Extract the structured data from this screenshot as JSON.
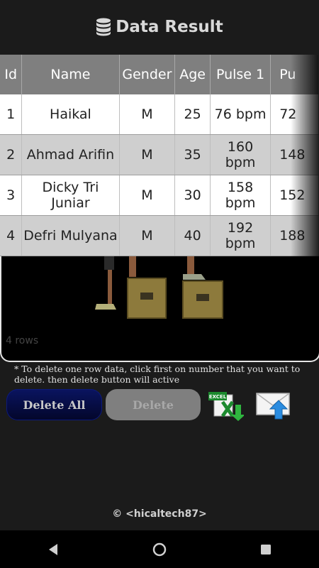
{
  "header": {
    "title": "Data Result",
    "icon": "database-icon"
  },
  "table": {
    "columns": [
      "Id",
      "Name",
      "Gender",
      "Age",
      "Pulse 1",
      "Pu"
    ],
    "rows": [
      [
        "1",
        "Haikal",
        "M",
        "25",
        "76 bpm",
        "72"
      ],
      [
        "2",
        "Ahmad Arifin",
        "M",
        "35",
        "160 bpm",
        "148"
      ],
      [
        "3",
        "Dicky Tri Juniar",
        "M",
        "30",
        "158 bpm",
        "152"
      ],
      [
        "4",
        "Defri Mulyana",
        "M",
        "40",
        "192 bpm",
        "188"
      ]
    ]
  },
  "rows_label": "4 rows",
  "note": "* To delete one row data, click first on number that you want to delete. then delete button will active",
  "buttons": {
    "delete_all": "Delete All",
    "delete": "Delete"
  },
  "icons": {
    "excel": "excel-export-icon",
    "mail": "email-send-icon"
  },
  "footer": "© <hicaltech87>",
  "navbar": {
    "back": "back-icon",
    "home": "home-icon",
    "recents": "recents-icon"
  }
}
